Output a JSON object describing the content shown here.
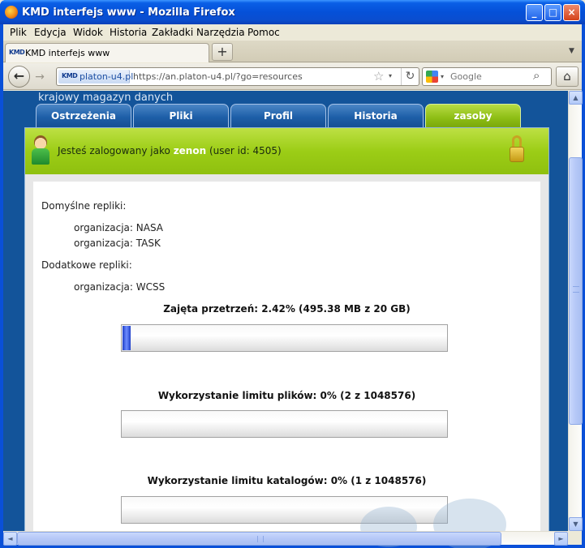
{
  "window": {
    "title": "KMD interfejs www - Mozilla Firefox",
    "min_label": "_",
    "max_label": "□",
    "close_label": "×"
  },
  "menu": [
    "Plik",
    "Edycja",
    "Widok",
    "Historia",
    "Zakładki",
    "Narzędzia",
    "Pomoc"
  ],
  "tab": {
    "favicon": "KMD",
    "label": "KMD interfejs www",
    "new_tab": "+",
    "list_arrow": "▼"
  },
  "nav": {
    "back_icon": "←",
    "forward_icon": "→",
    "site_badge": "platon-u4.pl",
    "site_badge_icon": "KMD",
    "url": "https://an.platon-u4.pl/?go=resources",
    "star_icon": "☆",
    "dropdown_icon": "▾",
    "reload_icon": "↻",
    "search_placeholder": "Google",
    "search_icon": "⌕",
    "home_icon": "⌂"
  },
  "site": {
    "tagline": "krajowy magazyn danych",
    "tabs": [
      "Ostrzeżenia",
      "Pliki",
      "Profil",
      "Historia",
      "zasoby"
    ],
    "active_tab": "zasoby",
    "login": {
      "prefix": "Jesteś zalogowany jako",
      "username": "zenon",
      "user_id": "(user id: 4505)"
    },
    "default_replicas_label": "Domyślne repliki:",
    "default_replicas": [
      "organizacja: NASA",
      "organizacja: TASK"
    ],
    "extra_replicas_label": "Dodatkowe repliki:",
    "extra_replicas": [
      "organizacja: WCSS"
    ],
    "bars": [
      {
        "label": "Zajęta przetrzeń: 2.42% (495.38 MB z 20 GB)",
        "fraction": 0.0242
      },
      {
        "label": "Wykorzystanie limitu plików: 0% (2 z 1048576)",
        "fraction": 0.0
      },
      {
        "label": "Wykorzystanie limitu katalogów: 0% (1 z 1048576)",
        "fraction": 0.0
      }
    ]
  },
  "scroll": {
    "up": "▲",
    "down": "▼",
    "left": "◄",
    "right": "►"
  }
}
